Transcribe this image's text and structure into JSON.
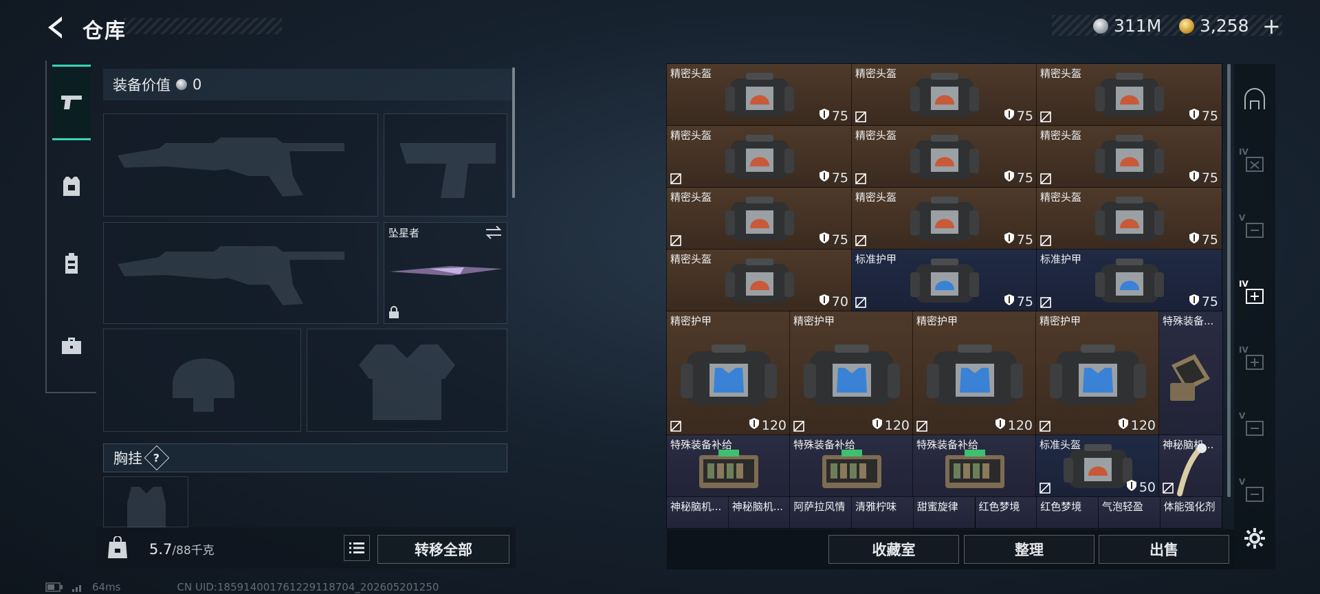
{
  "header": {
    "title": "仓库",
    "currency_silver": "311M",
    "currency_gold": "3,258",
    "plus_label": "+"
  },
  "left": {
    "equip_value_label": "装备价值",
    "equip_value": "0",
    "melee_name": "坠星者",
    "vest_label": "胸挂",
    "vest_help": "?",
    "weight_current": "5.7",
    "weight_cap": "/88千克",
    "transfer_all": "转移全部"
  },
  "grid": {
    "row1": [
      {
        "name": "精密头盔",
        "dur": "75"
      },
      {
        "name": "精密头盔",
        "dur": "75"
      },
      {
        "name": "精密头盔",
        "dur": "75"
      }
    ],
    "row2": [
      {
        "name": "精密头盔",
        "dur": "75"
      },
      {
        "name": "精密头盔",
        "dur": "75"
      },
      {
        "name": "精密头盔",
        "dur": "75"
      }
    ],
    "row3": [
      {
        "name": "精密头盔",
        "dur": "75"
      },
      {
        "name": "精密头盔",
        "dur": "75"
      },
      {
        "name": "精密头盔",
        "dur": "75"
      }
    ],
    "row4": [
      {
        "name": "精密头盔",
        "dur": "70"
      },
      {
        "name": "标准护甲",
        "dur": "75"
      },
      {
        "name": "标准护甲",
        "dur": "75"
      }
    ],
    "row5": [
      {
        "name": "精密护甲",
        "dur": "120"
      },
      {
        "name": "精密护甲",
        "dur": "120"
      },
      {
        "name": "精密护甲",
        "dur": "120"
      },
      {
        "name": "精密护甲",
        "dur": "120"
      },
      {
        "name": "特殊装备..."
      }
    ],
    "row6": [
      {
        "name": "特殊装备补给"
      },
      {
        "name": "特殊装备补给"
      },
      {
        "name": "特殊装备补给"
      },
      {
        "name": "标准头盔",
        "dur": "50"
      },
      {
        "name": "神秘脑机..."
      }
    ],
    "row7": [
      "神秘脑机...",
      "神秘脑机...",
      "阿萨拉风情",
      "清雅柠味",
      "甜蜜旋律",
      "红色梦境",
      "红色梦境",
      "气泡轻盈",
      "体能强化剂"
    ]
  },
  "bottom": {
    "collection": "收藏室",
    "sort": "整理",
    "sell": "出售"
  },
  "status": {
    "ping": "64ms",
    "uid": "CN UID:185914001761229118704_202605201250"
  },
  "colors": {
    "accent": "#37d6b5",
    "cell_brown": "#4e3a2a",
    "cell_blue": "#222337"
  },
  "icons": [
    "back-arrow-icon",
    "silver-coin-icon",
    "gold-coin-icon",
    "pistol-icon",
    "armor-icon",
    "backpack-icon",
    "toolbox-icon",
    "shield-icon",
    "lock-icon",
    "swap-icon",
    "list-icon",
    "gear-icon"
  ]
}
